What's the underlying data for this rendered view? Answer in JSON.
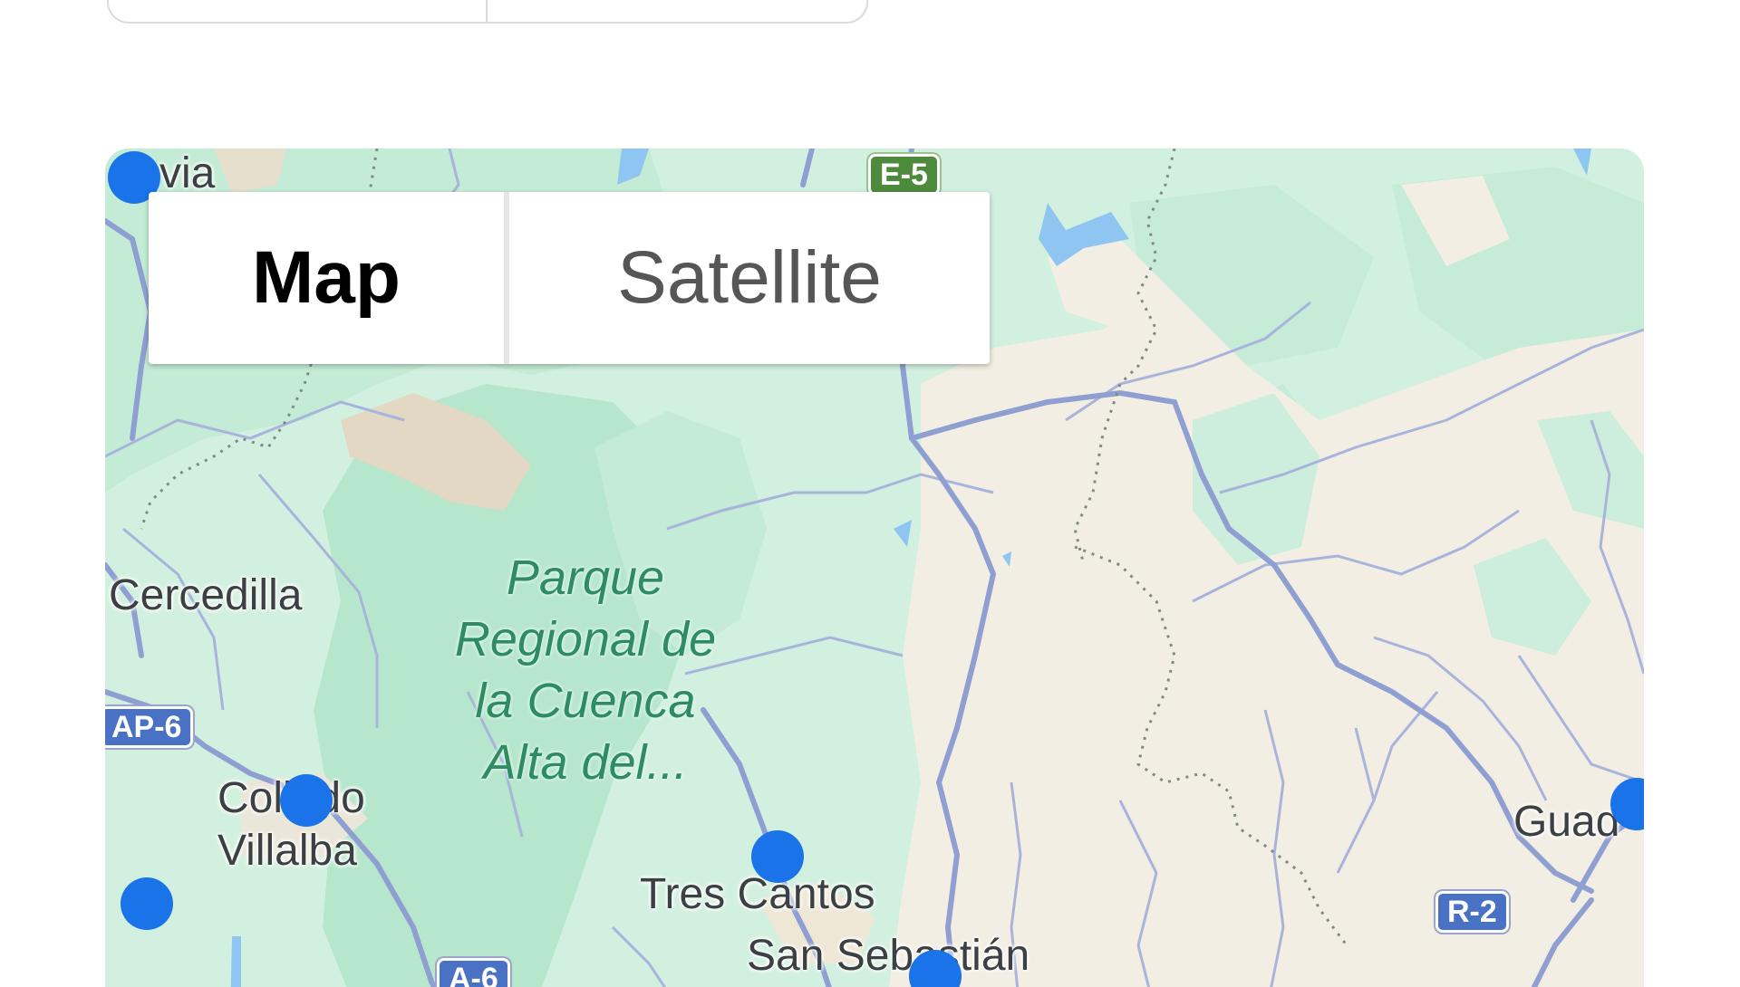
{
  "map_type_control": {
    "options": [
      "Map",
      "Satellite"
    ],
    "selected": "Map"
  },
  "labels": {
    "segovia_partial": "via",
    "cercedilla": "Cercedilla",
    "collado_line1": "Collado",
    "collado_line2": "Villalba",
    "tres_cantos": "Tres Cantos",
    "san_sebastian": "San Sebastián",
    "guadalajara_partial": "Guad",
    "park": "Parque\nRegional de\nla Cuenca\nAlta del..."
  },
  "road_shields": {
    "e5": "E-5",
    "ap6": "AP-6",
    "a6": "A-6",
    "r2": "R-2"
  },
  "colors": {
    "marker": "#1a73e8",
    "park_text": "#2e8c63",
    "forest": "#bfe9d2",
    "urban": "#f1ece1",
    "road": "#8f9fd2"
  },
  "markers_count": 7
}
